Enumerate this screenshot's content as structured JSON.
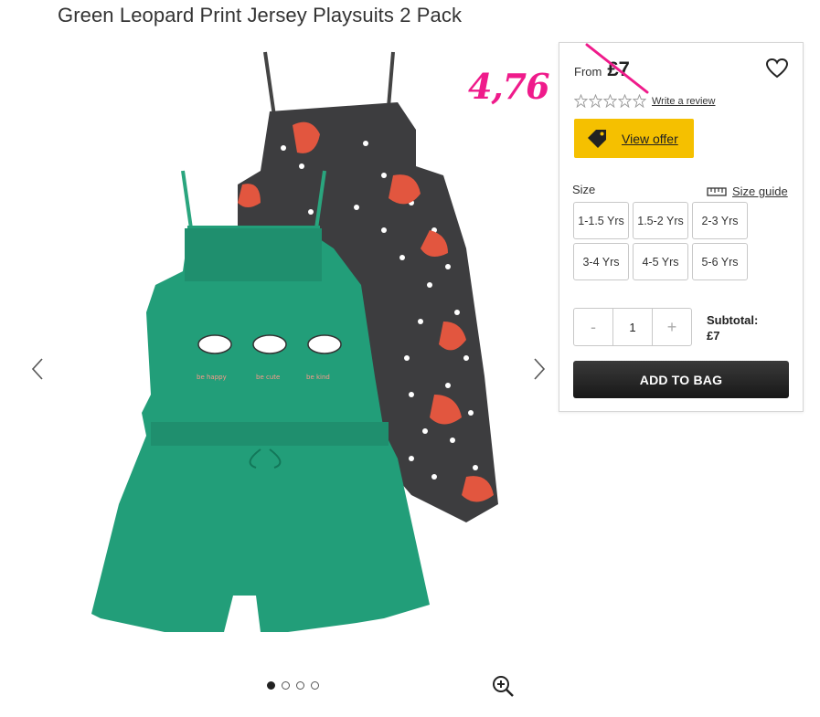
{
  "product": {
    "title": "Green Leopard Print Jersey Playsuits 2 Pack",
    "annotation": "4,76"
  },
  "gallery": {
    "image_alt": "Green and grey playsuits two pack",
    "dots_total": 4,
    "active_dot": 1
  },
  "panel": {
    "price_from": "From",
    "price": "£7",
    "review_link": "Write a review",
    "rating": 0,
    "offer_label": "View offer",
    "size_label": "Size",
    "size_guide": "Size guide",
    "sizes": [
      "1-1.5 Yrs",
      "1.5-2 Yrs",
      "2-3 Yrs",
      "3-4 Yrs",
      "4-5 Yrs",
      "5-6 Yrs"
    ],
    "qty_minus": "-",
    "qty_value": "1",
    "qty_plus": "+",
    "subtotal_label": "Subtotal:",
    "subtotal_value": "£7",
    "add_to_bag": "ADD TO BAG"
  },
  "colors": {
    "offer_yellow": "#f5c000",
    "annotation_pink": "#ef1b8b",
    "button_dark": "#222222"
  },
  "icons": {
    "prev": "chevron-left-icon",
    "next": "chevron-right-icon",
    "zoom": "zoom-in-icon",
    "wishlist": "heart-icon",
    "offer": "tag-icon",
    "size_guide": "ruler-icon"
  }
}
